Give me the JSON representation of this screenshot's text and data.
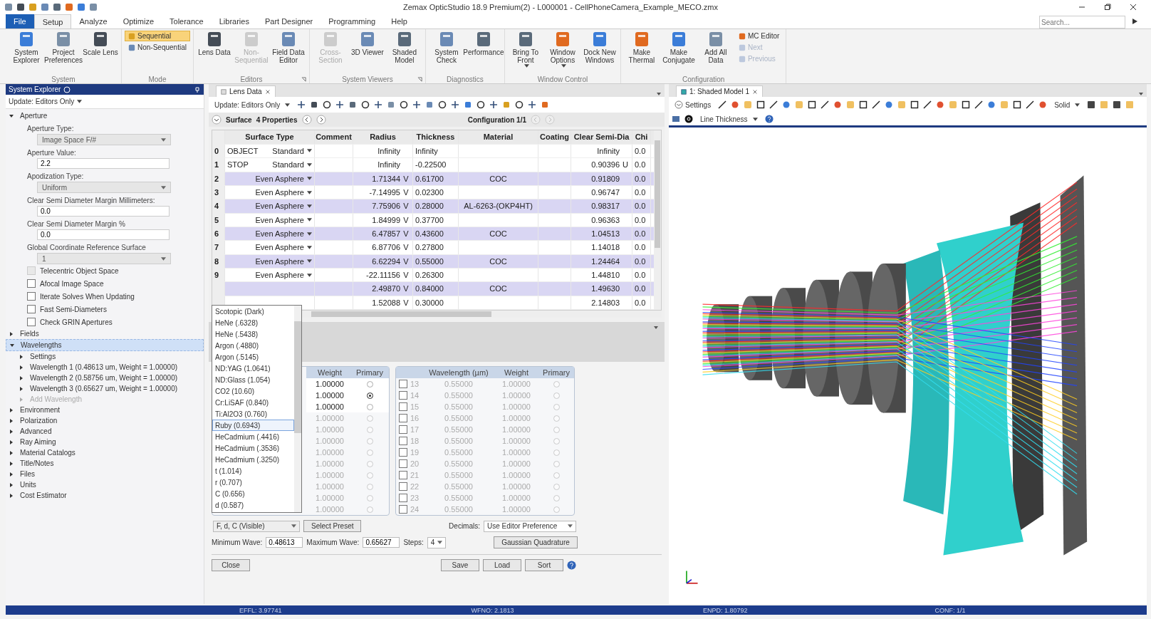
{
  "title_bar": {
    "title": "Zemax OpticStudio 18.9    Premium(2) - L000001 - CellPhoneCamera_Example_MECO.zmx"
  },
  "menu_tabs": [
    {
      "label": "File",
      "kind": "file",
      "selected": false
    },
    {
      "label": "Setup",
      "kind": "tab",
      "selected": true
    },
    {
      "label": "Analyze",
      "kind": "tab",
      "selected": false
    },
    {
      "label": "Optimize",
      "kind": "tab",
      "selected": false
    },
    {
      "label": "Tolerance",
      "kind": "tab",
      "selected": false
    },
    {
      "label": "Libraries",
      "kind": "tab",
      "selected": false
    },
    {
      "label": "Part Designer",
      "kind": "tab",
      "selected": false
    },
    {
      "label": "Programming",
      "kind": "tab",
      "selected": false
    },
    {
      "label": "Help",
      "kind": "tab",
      "selected": false
    }
  ],
  "search": {
    "placeholder": "Search..."
  },
  "ribbon_groups": [
    {
      "label": "System",
      "buttons": [
        {
          "label": "System Explorer",
          "kind": "large",
          "disabled": false
        },
        {
          "label": "Project Preferences",
          "kind": "large",
          "disabled": false
        },
        {
          "label": "Scale Lens",
          "kind": "large",
          "disabled": false
        }
      ]
    },
    {
      "label": "Mode",
      "buttons": [
        {
          "label": "Sequential",
          "kind": "small",
          "disabled": false,
          "selected": true
        },
        {
          "label": "Non-Sequential",
          "kind": "small",
          "disabled": false,
          "selected": false
        }
      ]
    },
    {
      "label": "Editors",
      "launcher": true,
      "buttons": [
        {
          "label": "Lens Data",
          "kind": "large",
          "disabled": false
        },
        {
          "label": "Non-Sequential",
          "kind": "large",
          "disabled": true
        },
        {
          "label": "Field Data Editor",
          "kind": "large",
          "disabled": false
        }
      ]
    },
    {
      "label": "System Viewers",
      "launcher": true,
      "buttons": [
        {
          "label": "Cross-Section",
          "kind": "large",
          "disabled": true
        },
        {
          "label": "3D Viewer",
          "kind": "large",
          "disabled": false
        },
        {
          "label": "Shaded Model",
          "kind": "large",
          "disabled": false
        }
      ]
    },
    {
      "label": "Diagnostics",
      "buttons": [
        {
          "label": "System Check",
          "kind": "large",
          "disabled": false
        },
        {
          "label": "Performance",
          "kind": "large",
          "disabled": false
        }
      ]
    },
    {
      "label": "Window Control",
      "buttons": [
        {
          "label": "Bring To Front",
          "kind": "large",
          "disabled": false,
          "caret": true
        },
        {
          "label": "Window Options",
          "kind": "large",
          "disabled": false,
          "caret": true
        },
        {
          "label": "Dock New Windows",
          "kind": "large",
          "disabled": false
        }
      ]
    },
    {
      "label": "Configuration",
      "buttons": [
        {
          "label": "Make Thermal",
          "kind": "large",
          "disabled": false
        },
        {
          "label": "Make Conjugate",
          "kind": "large",
          "disabled": false
        },
        {
          "label": "Add All Data",
          "kind": "large",
          "disabled": false
        },
        {
          "label": "MC Editor",
          "kind": "small",
          "disabled": false
        },
        {
          "label": "Next",
          "kind": "small",
          "disabled": true
        },
        {
          "label": "Previous",
          "kind": "small",
          "disabled": true
        }
      ]
    }
  ],
  "system_explorer": {
    "title": "System Explorer",
    "update": "Update: Editors Only",
    "tree": [
      {
        "label": "Aperture",
        "expanded": true,
        "selected": false,
        "fields": [
          {
            "kind": "select",
            "label": "Aperture Type:",
            "value": "Image Space F/#"
          },
          {
            "kind": "input",
            "label": "Aperture Value:",
            "value": "2.2"
          },
          {
            "kind": "select",
            "label": "Apodization Type:",
            "value": "Uniform"
          },
          {
            "kind": "input",
            "label": "Clear Semi Diameter Margin Millimeters:",
            "value": "0.0"
          },
          {
            "kind": "input",
            "label": "Clear Semi Diameter Margin %",
            "value": "0.0"
          },
          {
            "kind": "select",
            "label": "Global Coordinate Reference Surface",
            "value": "1"
          },
          {
            "kind": "checkbox",
            "label": "Telecentric Object Space",
            "checked": false,
            "disabled": true
          },
          {
            "kind": "checkbox",
            "label": "Afocal Image Space",
            "checked": false,
            "disabled": false
          },
          {
            "kind": "checkbox",
            "label": "Iterate Solves When Updating",
            "checked": false,
            "disabled": false
          },
          {
            "kind": "checkbox",
            "label": "Fast Semi-Diameters",
            "checked": false,
            "disabled": false
          },
          {
            "kind": "checkbox",
            "label": "Check GRIN Apertures",
            "checked": false,
            "disabled": false
          }
        ]
      },
      {
        "label": "Fields",
        "expanded": false,
        "selected": false
      },
      {
        "label": "Wavelengths",
        "expanded": true,
        "selected": true,
        "children": [
          {
            "label": "Settings",
            "expanded": false,
            "disabled": false
          },
          {
            "label": "Wavelength 1 (0.48613 um, Weight = 1.00000)",
            "expanded": false,
            "disabled": false
          },
          {
            "label": "Wavelength 2 (0.58756 um, Weight = 1.00000)",
            "expanded": false,
            "disabled": false
          },
          {
            "label": "Wavelength 3 (0.65627 um, Weight = 1.00000)",
            "expanded": false,
            "disabled": false
          },
          {
            "label": "Add Wavelength",
            "expanded": false,
            "disabled": true
          }
        ]
      },
      {
        "label": "Environment",
        "expanded": false,
        "selected": false
      },
      {
        "label": "Polarization",
        "expanded": false,
        "selected": false
      },
      {
        "label": "Advanced",
        "expanded": false,
        "selected": false
      },
      {
        "label": "Ray Aiming",
        "expanded": false,
        "selected": false
      },
      {
        "label": "Material Catalogs",
        "expanded": false,
        "selected": false
      },
      {
        "label": "Title/Notes",
        "expanded": false,
        "selected": false
      },
      {
        "label": "Files",
        "expanded": false,
        "selected": false
      },
      {
        "label": "Units",
        "expanded": false,
        "selected": false
      },
      {
        "label": "Cost Estimator",
        "expanded": false,
        "selected": false
      }
    ]
  },
  "lens_data": {
    "tab": "Lens Data",
    "update": "Update: Editors Only",
    "surface": "Surface",
    "properties": "4 Properties",
    "configuration": "Configuration 1/1",
    "columns": [
      "Surface Type",
      "Comment",
      "Radius",
      "Thickness",
      "Material",
      "Coating",
      "Clear Semi-Dia",
      "Chi"
    ],
    "rows": [
      {
        "number": "0",
        "label": "OBJECT",
        "surface_type": "Standard",
        "radius": "Infinity",
        "thickness": "Infinity",
        "clear_semi_dia": "Infinity",
        "chip": "0.0",
        "highlighted": false
      },
      {
        "number": "1",
        "label": "STOP",
        "surface_type": "Standard",
        "radius": "Infinity",
        "thickness": "-0.22500",
        "clear_semi_dia": "0.90396",
        "clear_solve": "U",
        "chip": "0.0",
        "highlighted": false
      },
      {
        "number": "2",
        "surface_type": "Even Asphere",
        "radius": "1.71344",
        "radius_solve": "V",
        "thickness": "0.61700",
        "material": "COC",
        "clear_semi_dia": "0.91809",
        "chip": "0.0",
        "highlighted": true
      },
      {
        "number": "3",
        "surface_type": "Even Asphere",
        "radius": "-7.14995",
        "radius_solve": "V",
        "thickness": "0.02300",
        "clear_semi_dia": "0.96747",
        "chip": "0.0",
        "highlighted": false
      },
      {
        "number": "4",
        "surface_type": "Even Asphere",
        "radius": "7.75906",
        "radius_solve": "V",
        "thickness": "0.28000",
        "material": "AL-6263-(OKP4HT)",
        "clear_semi_dia": "0.98317",
        "chip": "0.0",
        "highlighted": true
      },
      {
        "number": "5",
        "surface_type": "Even Asphere",
        "radius": "1.84999",
        "radius_solve": "V",
        "thickness": "0.37700",
        "clear_semi_dia": "0.96363",
        "chip": "0.0",
        "highlighted": false
      },
      {
        "number": "6",
        "surface_type": "Even Asphere",
        "radius": "6.47857",
        "radius_solve": "V",
        "thickness": "0.43600",
        "material": "COC",
        "clear_semi_dia": "1.04513",
        "chip": "0.0",
        "highlighted": true
      },
      {
        "number": "7",
        "surface_type": "Even Asphere",
        "radius": "6.87706",
        "radius_solve": "V",
        "thickness": "0.27800",
        "clear_semi_dia": "1.14018",
        "chip": "0.0",
        "highlighted": false
      },
      {
        "number": "8",
        "surface_type": "Even Asphere",
        "radius": "6.62294",
        "radius_solve": "V",
        "thickness": "0.55000",
        "material": "COC",
        "clear_semi_dia": "1.24464",
        "chip": "0.0",
        "highlighted": true
      },
      {
        "number": "9",
        "surface_type": "Even Asphere",
        "radius": "-22.11156",
        "radius_solve": "V",
        "thickness": "0.26300",
        "clear_semi_dia": "1.44810",
        "chip": "0.0",
        "highlighted": false
      },
      {
        "radius": "2.49870",
        "radius_solve": "V",
        "thickness": "0.84000",
        "material": "COC",
        "clear_semi_dia": "1.49630",
        "chip": "0.0",
        "highlighted": true
      },
      {
        "radius": "1.52088",
        "radius_solve": "V",
        "thickness": "0.30000",
        "clear_semi_dia": "2.14803",
        "chip": "0.0",
        "highlighted": false
      }
    ]
  },
  "wavelength_dialog": {
    "preset_list": [
      {
        "label": "Scotopic (Dark)",
        "selected": false
      },
      {
        "label": "HeNe (.6328)",
        "selected": false
      },
      {
        "label": "HeNe (.5438)",
        "selected": false
      },
      {
        "label": "Argon (.4880)",
        "selected": false
      },
      {
        "label": "Argon (.5145)",
        "selected": false
      },
      {
        "label": "ND:YAG (1.0641)",
        "selected": false
      },
      {
        "label": "ND:Glass (1.054)",
        "selected": false
      },
      {
        "label": "CO2 (10.60)",
        "selected": false
      },
      {
        "label": "Cr:LiSAF (0.840)",
        "selected": false
      },
      {
        "label": "Ti:Al2O3 (0.760)",
        "selected": false
      },
      {
        "label": "Ruby (0.6943)",
        "selected": true
      },
      {
        "label": "HeCadmium (.4416)",
        "selected": false
      },
      {
        "label": "HeCadmium (.3536)",
        "selected": false
      },
      {
        "label": "HeCadmium (.3250)",
        "selected": false
      },
      {
        "label": "t (1.014)",
        "selected": false
      },
      {
        "label": "r (0.707)",
        "selected": false
      },
      {
        "label": "C (0.656)",
        "selected": false
      },
      {
        "label": "d (0.587)",
        "selected": false
      }
    ],
    "left_columns": [
      "Weight",
      "Primary"
    ],
    "left_rows": [
      {
        "weight": "1.00000",
        "primary": false,
        "enabled": true
      },
      {
        "weight": "1.00000",
        "primary": true,
        "enabled": true
      },
      {
        "weight": "1.00000",
        "primary": false,
        "enabled": true
      },
      {
        "weight": "1.00000",
        "primary": false,
        "enabled": false
      },
      {
        "weight": "1.00000",
        "primary": false,
        "enabled": false
      },
      {
        "weight": "1.00000",
        "primary": false,
        "enabled": false
      },
      {
        "weight": "1.00000",
        "primary": false,
        "enabled": false
      },
      {
        "weight": "1.00000",
        "primary": false,
        "enabled": false
      },
      {
        "weight": "1.00000",
        "primary": false,
        "enabled": false
      },
      {
        "weight": "1.00000",
        "primary": false,
        "enabled": false
      },
      {
        "weight": "1.00000",
        "primary": false,
        "enabled": false
      },
      {
        "weight": "1.00000",
        "primary": false,
        "enabled": false
      }
    ],
    "right_columns": [
      "Wavelength (µm)",
      "Weight",
      "Primary"
    ],
    "right_rows": [
      {
        "checked": false,
        "number": "13",
        "wavelength": "0.55000",
        "weight": "1.00000",
        "primary": false,
        "enabled": false
      },
      {
        "checked": false,
        "number": "14",
        "wavelength": "0.55000",
        "weight": "1.00000",
        "primary": false,
        "enabled": false
      },
      {
        "checked": false,
        "number": "15",
        "wavelength": "0.55000",
        "weight": "1.00000",
        "primary": false,
        "enabled": false
      },
      {
        "checked": false,
        "number": "16",
        "wavelength": "0.55000",
        "weight": "1.00000",
        "primary": false,
        "enabled": false
      },
      {
        "checked": false,
        "number": "17",
        "wavelength": "0.55000",
        "weight": "1.00000",
        "primary": false,
        "enabled": false
      },
      {
        "checked": false,
        "number": "18",
        "wavelength": "0.55000",
        "weight": "1.00000",
        "primary": false,
        "enabled": false
      },
      {
        "checked": false,
        "number": "19",
        "wavelength": "0.55000",
        "weight": "1.00000",
        "primary": false,
        "enabled": false
      },
      {
        "checked": false,
        "number": "20",
        "wavelength": "0.55000",
        "weight": "1.00000",
        "primary": false,
        "enabled": false
      },
      {
        "checked": false,
        "number": "21",
        "wavelength": "0.55000",
        "weight": "1.00000",
        "primary": false,
        "enabled": false
      },
      {
        "checked": false,
        "number": "22",
        "wavelength": "0.55000",
        "weight": "1.00000",
        "primary": false,
        "enabled": false
      },
      {
        "checked": false,
        "number": "23",
        "wavelength": "0.55000",
        "weight": "1.00000",
        "primary": false,
        "enabled": false
      },
      {
        "checked": false,
        "number": "24",
        "wavelength": "0.55000",
        "weight": "1.00000",
        "primary": false,
        "enabled": false
      }
    ],
    "preset": "F, d, C (Visible)",
    "select_preset": "Select Preset",
    "decimals_label": "Decimals:",
    "decimals": "Use Editor Preference",
    "min_label": "Minimum Wave:",
    "min_value": "0.48613",
    "max_label": "Maximum Wave:",
    "max_value": "0.65627",
    "steps_label": "Steps:",
    "steps": "4",
    "gaussian": "Gaussian Quadrature",
    "close": "Close",
    "buttons": [
      "Save",
      "Load",
      "Sort"
    ]
  },
  "shaded_model": {
    "tab": "1: Shaded Model 1",
    "settings": "Settings",
    "solid": "Solid",
    "line_thickness": "Line Thickness"
  },
  "status_bar": [
    "EFFL: 3.97741",
    "WFNO: 2.1813",
    "ENPD: 1.80792",
    "CONF: 1/1"
  ]
}
